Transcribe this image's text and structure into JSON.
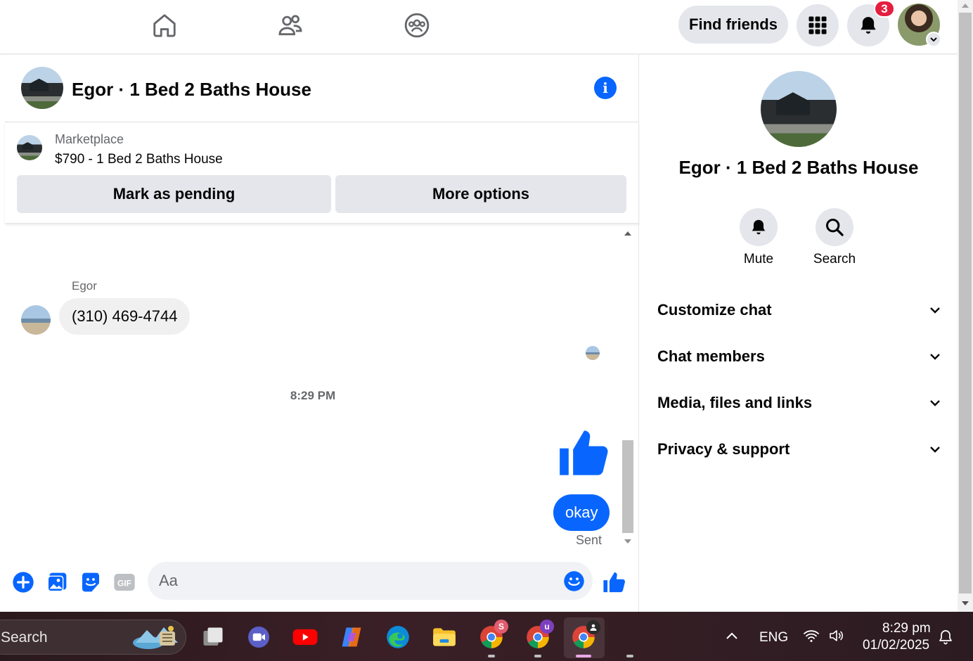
{
  "topnav": {
    "find_friends_label": "Find friends",
    "notification_count": "3"
  },
  "chat": {
    "title": "Egor · 1 Bed 2 Baths House",
    "marketplace_label": "Marketplace",
    "listing": "$790 - 1 Bed 2 Baths House",
    "mark_pending_label": "Mark as pending",
    "more_options_label": "More options",
    "sender_name": "Egor",
    "incoming_message": "(310) 469-4744",
    "timestamp": "8:29 PM",
    "outgoing_message": "okay",
    "sent_status": "Sent",
    "composer_placeholder": "Aa"
  },
  "info_panel": {
    "name": "Egor · 1 Bed 2 Baths House",
    "mute_label": "Mute",
    "search_label": "Search",
    "sections": [
      {
        "label": "Customize chat"
      },
      {
        "label": "Chat members"
      },
      {
        "label": "Media, files and links"
      },
      {
        "label": "Privacy & support"
      }
    ]
  },
  "taskbar": {
    "search_text": "Search",
    "language": "ENG",
    "time": "8:29 pm",
    "date": "01/02/2025",
    "chrome_badge_1": "S",
    "chrome_badge_2": "u"
  },
  "colors": {
    "accent": "#0866ff",
    "badge": "#e41e3f",
    "button_bg": "#e4e6eb"
  }
}
